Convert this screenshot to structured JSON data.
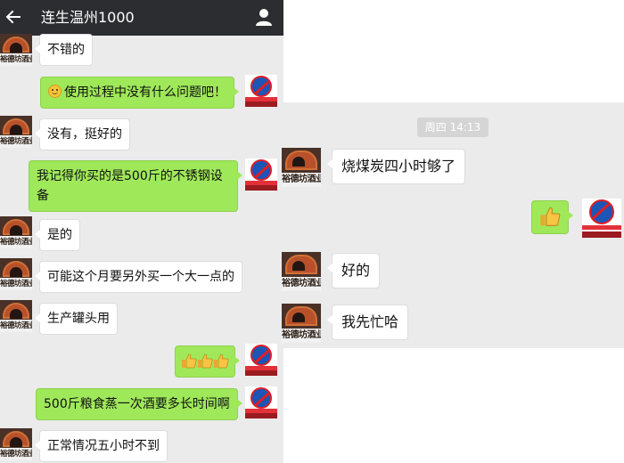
{
  "left": {
    "title": "连生温州1000",
    "messages": [
      {
        "side": "left",
        "text": "不错的"
      },
      {
        "side": "right",
        "emoji": "smiley",
        "text": "使用过程中没有什么问题吧！"
      },
      {
        "side": "left",
        "text": "没有，挺好的"
      },
      {
        "side": "right",
        "text": "我记得你买的是500斤的不锈钢设备"
      },
      {
        "side": "left",
        "text": "是的"
      },
      {
        "side": "left",
        "text": "可能这个月要另外买一个大一点的"
      },
      {
        "side": "left",
        "text": "生产罐头用"
      },
      {
        "side": "right",
        "emoji": "thumbs-up-x3"
      },
      {
        "side": "right",
        "text": "500斤粮食蒸一次酒要多长时间啊"
      },
      {
        "side": "left",
        "text": "正常情况五小时不到"
      }
    ]
  },
  "right": {
    "timestamp": "周四 14:13",
    "messages": [
      {
        "side": "left",
        "text": "烧煤炭四小时够了"
      },
      {
        "side": "right",
        "emoji": "thumbs-up"
      },
      {
        "side": "left",
        "text": "好的"
      },
      {
        "side": "left",
        "text": "我先忙哈"
      }
    ]
  },
  "avatars": {
    "contact_label": "裕德坊酒业",
    "self_icon": "brand-logo-icon"
  },
  "icons": {
    "back": "back-arrow-icon",
    "profile": "person-icon",
    "smiley": "smiley-icon",
    "thumbs_up": "thumbs-up-icon"
  },
  "colors": {
    "topbar": "#2c2d31",
    "chat_bg": "#ebebeb",
    "bubble_sent": "#9fe85a",
    "bubble_received": "#ffffff"
  }
}
